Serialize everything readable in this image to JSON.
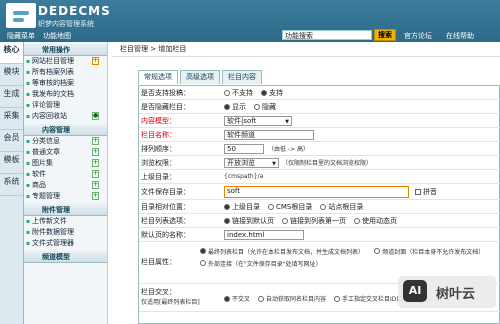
{
  "brand": {
    "name": "DEDECMS",
    "version": "v5.7",
    "subtitle": "织梦内容管理系统"
  },
  "top_nav": [
    "隐藏菜单",
    "功能地图"
  ],
  "search": {
    "placeholder": "功能搜索",
    "button": "搜索"
  },
  "top_links": [
    "官方论坛",
    "在线帮助"
  ],
  "left_tabs": [
    "核心",
    "模块",
    "生成",
    "采集",
    "会员",
    "模板",
    "系统"
  ],
  "sidebar": {
    "common_title": "常用操作",
    "common_items": [
      "网站栏目管理",
      "所有档案列表",
      "等审核的档案",
      "我发布的文档",
      "评论管理",
      "内容回收站"
    ],
    "content_title": "内容管理",
    "content_items": [
      "分类信息",
      "普通文章",
      "图片集",
      "软件",
      "商品",
      "专题管理"
    ],
    "attachment_title": "附件管理",
    "attachment_items": [
      "上传新文件",
      "附件数据管理",
      "文件式管理器"
    ],
    "channel_title": "频道模型"
  },
  "breadcrumb": {
    "part1": "栏目管理",
    "sep": ">",
    "part2": "增加栏目"
  },
  "tabs": [
    "常规选项",
    "高级选项",
    "栏目内容"
  ],
  "form": {
    "support_post": {
      "label": "是否支持投稿：",
      "options": [
        "不支持",
        "支持"
      ]
    },
    "hidden_column": {
      "label": "是否隐藏栏目：",
      "options": [
        "显示",
        "隐藏"
      ]
    },
    "content_model": {
      "label": "内容模型：",
      "value": "软件|soft"
    },
    "column_name": {
      "label": "栏目名称：",
      "value": "软件频道"
    },
    "sort_order": {
      "label": "排列顺序：",
      "value": "50",
      "hint": "（由低 -> 高）"
    },
    "browse_permission": {
      "label": "浏览权限：",
      "value": "开放浏览",
      "hint": "（仅限制栏目里的文档浏览权限）"
    },
    "parent_dir": {
      "label": "上级目录：",
      "value": "{cmspath}/a"
    },
    "save_dir": {
      "label": "文件保存目录：",
      "value": "soft",
      "extra": "拼音"
    },
    "relative_position": {
      "label": "目录相对位置：",
      "options": [
        "上级目录",
        "CMS根目录",
        "站点根目录"
      ]
    },
    "list_option": {
      "label": "栏目列表选项：",
      "options": [
        "链接到默认页",
        "链接到列表第一页",
        "使用动态页"
      ]
    },
    "default_page": {
      "label": "默认页的名称：",
      "value": "index.html"
    },
    "column_attribute": {
      "label": "栏目属性：",
      "options": [
        "最终列表栏目（允许在本栏目发布文档，并生成文档列表）",
        "频道封面（栏目本身不允许发布文档）",
        "外部连接（在\"文件保存目录\"处填写网址）"
      ]
    },
    "cross_column": {
      "label": "栏目交叉：",
      "note": "仅适用[最终列表栏目]",
      "options": [
        "不交叉",
        "自动获取同名栏目内容",
        "手工指定交叉栏目ID(用逗号分开)"
      ]
    }
  },
  "watermark": "树叶云",
  "watermark_logo": "AI",
  "icons": [
    "logo-icon",
    "home-icon",
    "help-icon",
    "section-icon"
  ]
}
